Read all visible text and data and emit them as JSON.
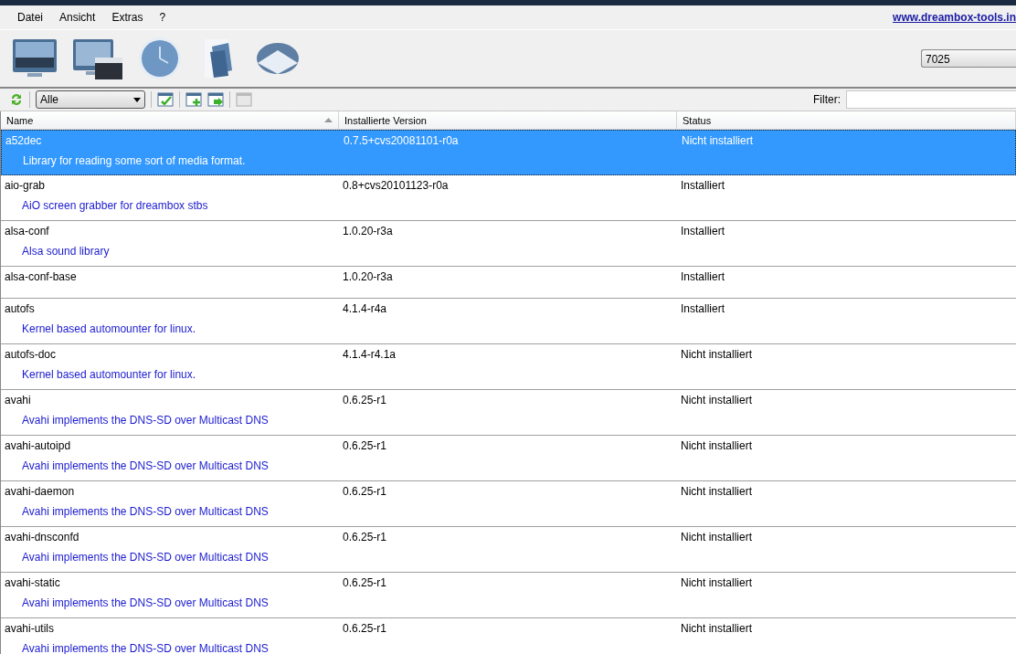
{
  "menu": [
    "Datei",
    "Ansicht",
    "Extras",
    "?"
  ],
  "website_link": "www.dreambox-tools.in",
  "big_toolbar": {
    "buttons": [
      {
        "kind": "tv"
      },
      {
        "kind": "tv-clapper"
      },
      {
        "kind": "clock"
      },
      {
        "kind": "files"
      },
      {
        "kind": "disc"
      }
    ],
    "box_select": "7025"
  },
  "filter_toolbar": {
    "category": "Alle",
    "filter_label": "Filter:"
  },
  "table": {
    "columns": [
      "Name",
      "Installierte Version",
      "Status"
    ],
    "rows": [
      {
        "name": "a52dec",
        "version": "0.7.5+cvs20081101-r0a",
        "status": "Nicht installiert",
        "description": "Library for reading some sort of media format.",
        "selected": true
      },
      {
        "name": "aio-grab",
        "version": "0.8+cvs20101123-r0a",
        "status": "Installiert",
        "description": "AiO screen grabber for dreambox stbs",
        "selected": false
      },
      {
        "name": "alsa-conf",
        "version": "1.0.20-r3a",
        "status": "Installiert",
        "description": "Alsa sound library",
        "selected": false
      },
      {
        "name": "alsa-conf-base",
        "version": "1.0.20-r3a",
        "status": "Installiert",
        "selected": false
      },
      {
        "name": "autofs",
        "version": "4.1.4-r4a",
        "status": "Installiert",
        "description": "Kernel based automounter for linux.",
        "selected": false
      },
      {
        "name": "autofs-doc",
        "version": "4.1.4-r4.1a",
        "status": "Nicht installiert",
        "description": "Kernel based automounter for linux.",
        "selected": false
      },
      {
        "name": "avahi",
        "version": "0.6.25-r1",
        "status": "Nicht installiert",
        "description": "Avahi implements the DNS-SD over Multicast DNS",
        "selected": false
      },
      {
        "name": "avahi-autoipd",
        "version": "0.6.25-r1",
        "status": "Nicht installiert",
        "description": "Avahi implements the DNS-SD over Multicast DNS",
        "selected": false
      },
      {
        "name": "avahi-daemon",
        "version": "0.6.25-r1",
        "status": "Nicht installiert",
        "description": "Avahi implements the DNS-SD over Multicast DNS",
        "selected": false
      },
      {
        "name": "avahi-dnsconfd",
        "version": "0.6.25-r1",
        "status": "Nicht installiert",
        "description": "Avahi implements the DNS-SD over Multicast DNS",
        "selected": false
      },
      {
        "name": "avahi-static",
        "version": "0.6.25-r1",
        "status": "Nicht installiert",
        "description": "Avahi implements the DNS-SD over Multicast DNS",
        "selected": false
      },
      {
        "name": "avahi-utils",
        "version": "0.6.25-r1",
        "status": "Nicht installiert",
        "description": "Avahi implements the DNS-SD over Multicast DNS",
        "selected": false
      }
    ]
  }
}
